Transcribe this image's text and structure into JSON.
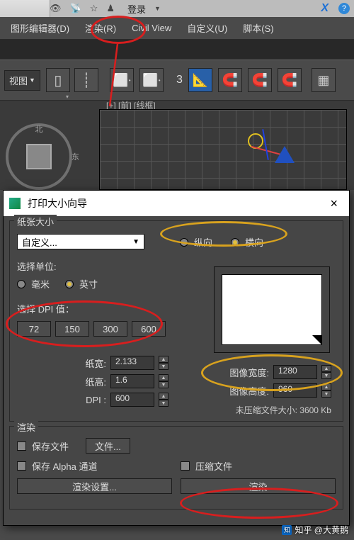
{
  "top": {
    "login": "登录",
    "blue_x": "X"
  },
  "menu": {
    "graph_editor": "图形编辑器(D)",
    "render": "渲染(R)",
    "civil_view": "Civil View",
    "customize": "自定义(U)",
    "script": "脚本(S)"
  },
  "toolbar": {
    "view_dropdown": "视图",
    "isolate_glyph": "▯",
    "controls_glyph": "┊",
    "three": "3",
    "angle_caret": "▾",
    "snap_glyph": "⬡"
  },
  "viewport": {
    "label": "[+] [前] [线框]",
    "compass_n": "北",
    "compass_e": "东"
  },
  "dialog": {
    "title": "打印大小向导",
    "close": "×",
    "paper_group": "纸张大小",
    "paper_dropdown": "自定义...",
    "orient_portrait": "纵向",
    "orient_landscape": "横向",
    "unit_label": "选择单位:",
    "unit_mm": "毫米",
    "unit_inch": "英寸",
    "dpi_label": "选择 DPI 值：",
    "dpi_72": "72",
    "dpi_150": "150",
    "dpi_300": "300",
    "dpi_600": "600",
    "paper_w_label": "纸宽:",
    "paper_w": "2.133",
    "paper_h_label": "纸高:",
    "paper_h": "1.6",
    "dpi_field_label": "DPI :",
    "dpi_field": "600",
    "img_w_label": "图像宽度:",
    "img_w": "1280",
    "img_h_label": "图像高度:",
    "img_h": "960",
    "uncompressed": "未压缩文件大小: 3600 Kb",
    "render_group": "渲染",
    "save_file": "保存文件",
    "file_btn": "文件...",
    "save_alpha": "保存 Alpha 通道",
    "compress": "压缩文件",
    "render_settings": "渲染设置...",
    "render_btn": "渲染"
  },
  "watermark": "知乎 @大黄鹅"
}
